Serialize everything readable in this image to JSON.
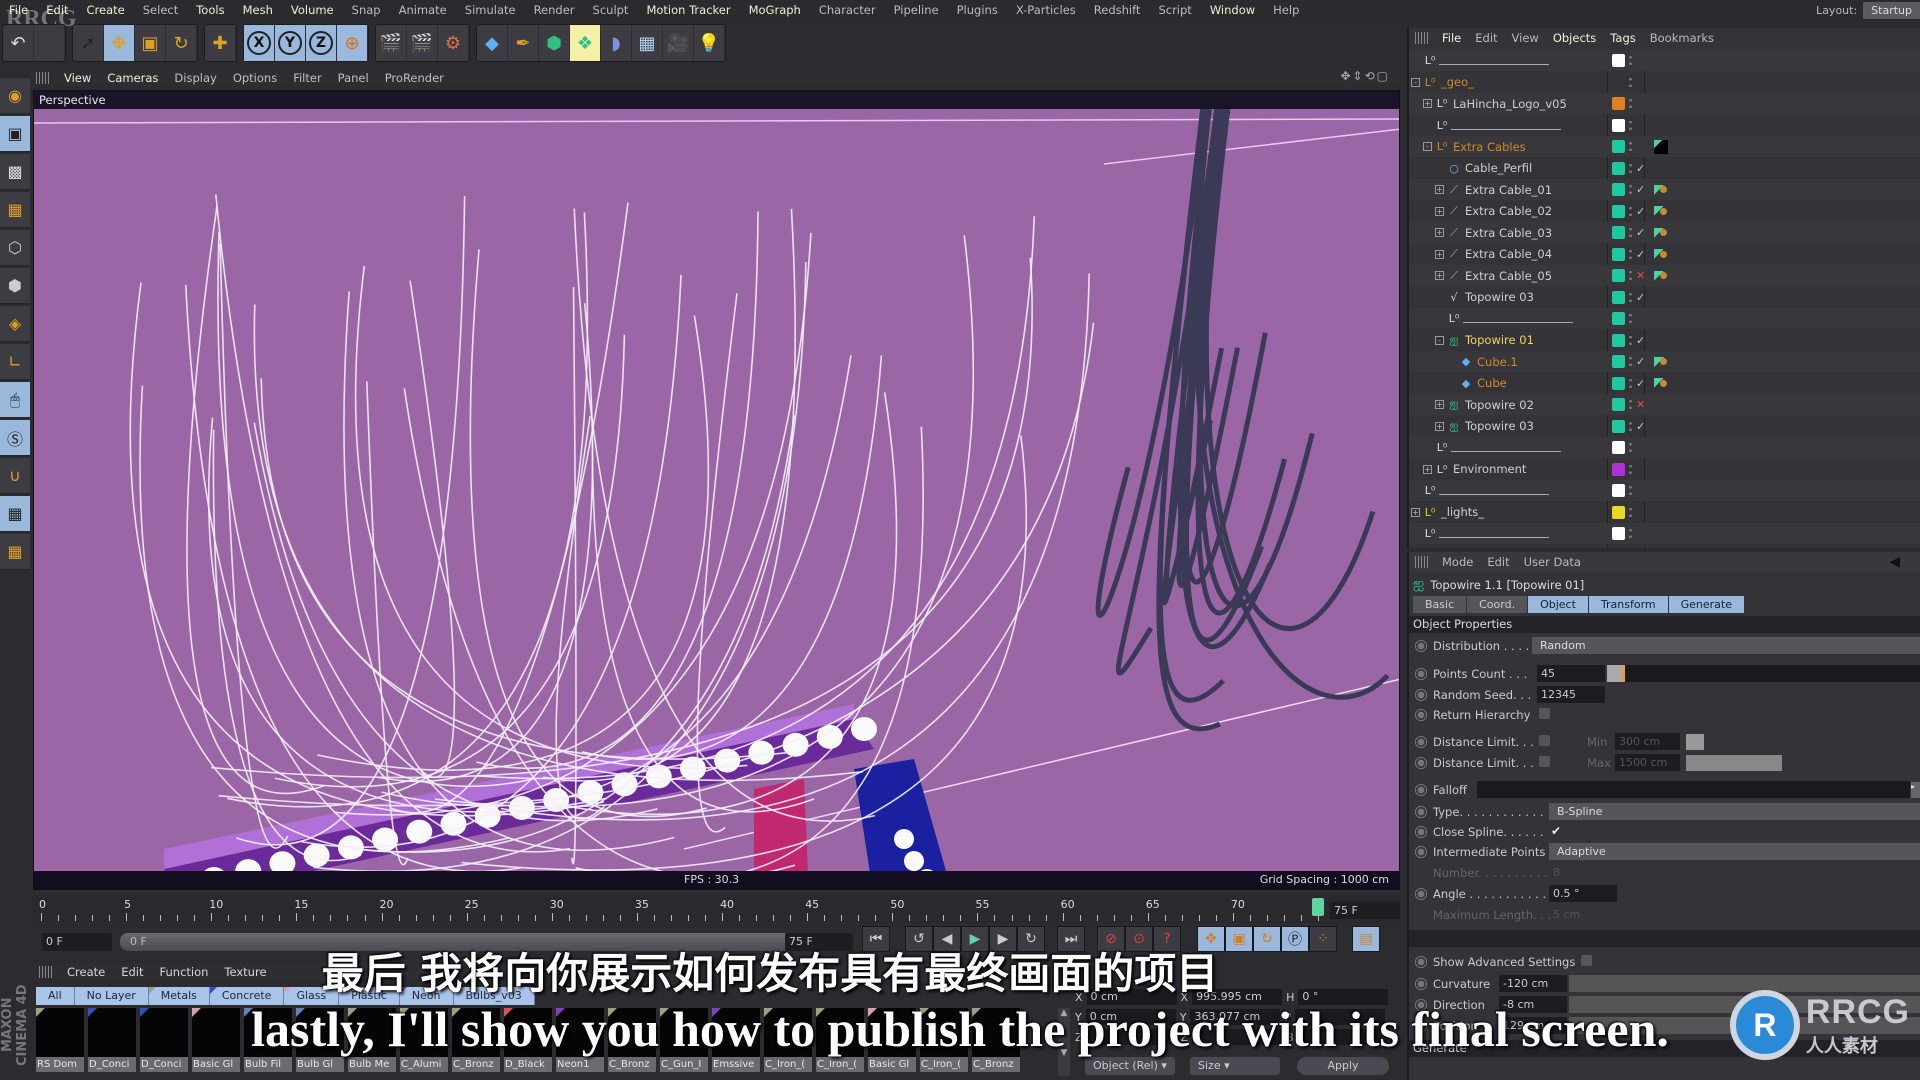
{
  "menubar": {
    "items": [
      "File",
      "Edit",
      "Create",
      "Select",
      "Tools",
      "Mesh",
      "Volume",
      "Snap",
      "Animate",
      "Simulate",
      "Render",
      "Sculpt",
      "Motion Tracker",
      "MoGraph",
      "Character",
      "Pipeline",
      "Plugins",
      "X-Particles",
      "Redshift",
      "Script",
      "Window",
      "Help"
    ],
    "layout_label": "Layout:",
    "layout_value": "Startup"
  },
  "toolbar": {
    "icons": [
      "undo-icon",
      "redo-icon",
      "select-icon",
      "move-icon",
      "scale-icon",
      "rotate-icon",
      "live-move-icon",
      "x-axis-icon",
      "y-axis-icon",
      "z-axis-icon",
      "world-coords-icon",
      "render-view-icon",
      "render-picture-viewer-icon",
      "render-settings-icon",
      "cube-icon",
      "pen-icon",
      "subdivision-icon",
      "cloner-icon",
      "deformer-icon",
      "floor-icon",
      "camera-icon",
      "light-icon"
    ],
    "axis_labels": [
      "X",
      "Y",
      "Z"
    ]
  },
  "viewport": {
    "menu": [
      "View",
      "Cameras",
      "Display",
      "Options",
      "Filter",
      "Panel",
      "ProRender"
    ],
    "label": "Perspective",
    "fps": "FPS : 30.3",
    "grid_spacing": "Grid Spacing : 1000 cm",
    "background_color": "#9a66a6"
  },
  "timeline": {
    "ticks": [
      0,
      5,
      10,
      15,
      20,
      25,
      30,
      35,
      40,
      45,
      50,
      55,
      60,
      65,
      70
    ],
    "current_frame": 75,
    "end_frame": "75 F",
    "start_field": "0 F",
    "range_start": "0 F",
    "range_end": "75 F",
    "range_end_field": "75 F"
  },
  "material_manager": {
    "menu": [
      "Create",
      "Edit",
      "Function",
      "Texture"
    ],
    "tabs": [
      {
        "label": "All",
        "color": "#a8c4e8"
      },
      {
        "label": "No Layer",
        "color": "#a8c4e8"
      },
      {
        "label": "Metals",
        "color": "#a0a080"
      },
      {
        "label": "Concrete",
        "color": "#3050c0"
      },
      {
        "label": "Glass",
        "color": "#d8a0b0"
      },
      {
        "label": "Plastic",
        "color": "#e05050"
      },
      {
        "label": "Neon",
        "color": "#8040c0"
      },
      {
        "label": "Bulbs_v03",
        "color": "#a8c4e8"
      }
    ],
    "materials": [
      {
        "name": "RS Dom",
        "color": "#a0a080"
      },
      {
        "name": "D_Conci",
        "color": "#3050c0"
      },
      {
        "name": "D_Conci",
        "color": "#3050c0"
      },
      {
        "name": "Basic Gl",
        "color": "#d8a0b0"
      },
      {
        "name": "Bulb Fil",
        "color": "#6080c0"
      },
      {
        "name": "Bulb Gl",
        "color": "#6080c0"
      },
      {
        "name": "Bulb Me",
        "color": "#a0a080"
      },
      {
        "name": "C_Alumi",
        "color": "#a0a080"
      },
      {
        "name": "C_Bronz",
        "color": "#a0a080"
      },
      {
        "name": "D_Black",
        "color": "#e05050"
      },
      {
        "name": "Neon1",
        "color": "#8040c0"
      },
      {
        "name": "C_Bronz",
        "color": "#a0a080"
      },
      {
        "name": "C_Gun_I",
        "color": "#a0a080"
      },
      {
        "name": "Emssive",
        "color": "#8040c0"
      },
      {
        "name": "C_Iron_(",
        "color": "#a0a080"
      },
      {
        "name": "C_Iron_(",
        "color": "#a0a080"
      },
      {
        "name": "Basic Gl",
        "color": "#d8a0b0"
      },
      {
        "name": "C_Iron_(",
        "color": "#a0a080"
      },
      {
        "name": "C_Bronz",
        "color": "#a0a080"
      }
    ]
  },
  "coordinates": {
    "position": {
      "x": "0 cm",
      "y": "0 cm"
    },
    "size": {
      "x": "995.995 cm",
      "y": "363.077 cm"
    },
    "rotation": {
      "h": "0 °"
    },
    "axis_labels": {
      "x": "X",
      "y": "Y",
      "z": "Z",
      "h": "H",
      "p": "P",
      "b": "B"
    },
    "mode_dropdown": "Object (Rel)",
    "size_dropdown": "Size",
    "apply_label": "Apply"
  },
  "object_manager": {
    "menu": [
      "File",
      "Edit",
      "View",
      "Objects",
      "Tags",
      "Bookmarks"
    ],
    "objects": [
      {
        "name": "",
        "type": "null-separator",
        "indent": 0,
        "swatch": "#ffffff",
        "check": ""
      },
      {
        "name": "_geo_",
        "type": "null",
        "indent": 0,
        "swatch": "",
        "check": "",
        "color": "orange",
        "expand": "-"
      },
      {
        "name": "LaHincha_Logo_v05",
        "type": "null",
        "indent": 1,
        "swatch": "#e08020",
        "check": "",
        "expand": "+"
      },
      {
        "name": "",
        "type": "null-separator",
        "indent": 1,
        "swatch": "#ffffff",
        "check": ""
      },
      {
        "name": "Extra Cables",
        "type": "null",
        "indent": 1,
        "swatch": "#1ec8a0",
        "check": "",
        "color": "orange",
        "expand": "-",
        "tag": "texture"
      },
      {
        "name": "Cable_Perfil",
        "type": "circle",
        "indent": 2,
        "swatch": "#1ec8a0",
        "check": "ok"
      },
      {
        "name": "Extra Cable_01",
        "type": "sweep",
        "indent": 2,
        "swatch": "#1ec8a0",
        "check": "ok",
        "expand": "+",
        "tag": "material"
      },
      {
        "name": "Extra Cable_02",
        "type": "sweep",
        "indent": 2,
        "swatch": "#1ec8a0",
        "check": "ok",
        "expand": "+",
        "tag": "material"
      },
      {
        "name": "Extra Cable_03",
        "type": "sweep",
        "indent": 2,
        "swatch": "#1ec8a0",
        "check": "ok",
        "expand": "+",
        "tag": "material"
      },
      {
        "name": "Extra Cable_04",
        "type": "sweep",
        "indent": 2,
        "swatch": "#1ec8a0",
        "check": "ok",
        "expand": "+",
        "tag": "material"
      },
      {
        "name": "Extra Cable_05",
        "type": "sweep",
        "indent": 2,
        "swatch": "#1ec8a0",
        "check": "off",
        "expand": "+",
        "tag": "material"
      },
      {
        "name": "Topowire 03",
        "type": "spline",
        "indent": 2,
        "swatch": "#1ec8a0",
        "check": "ok"
      },
      {
        "name": "",
        "type": "null-separator",
        "indent": 2,
        "swatch": "#1ec8a0",
        "check": ""
      },
      {
        "name": "Topowire 01",
        "type": "topowire",
        "indent": 2,
        "swatch": "#1ec8a0",
        "check": "ok",
        "color": "yellow",
        "expand": "-"
      },
      {
        "name": "Cube.1",
        "type": "cube",
        "indent": 3,
        "swatch": "#1ec8a0",
        "check": "ok",
        "color": "orange",
        "tag": "material"
      },
      {
        "name": "Cube",
        "type": "cube",
        "indent": 3,
        "swatch": "#1ec8a0",
        "check": "ok",
        "color": "orange",
        "tag": "material"
      },
      {
        "name": "Topowire 02",
        "type": "topowire",
        "indent": 2,
        "swatch": "#1ec8a0",
        "check": "off",
        "expand": "+"
      },
      {
        "name": "Topowire 03",
        "type": "topowire",
        "indent": 2,
        "swatch": "#1ec8a0",
        "check": "ok",
        "expand": "+"
      },
      {
        "name": "",
        "type": "null-separator",
        "indent": 1,
        "swatch": "#ffffff",
        "check": ""
      },
      {
        "name": "Environment",
        "type": "null",
        "indent": 1,
        "swatch": "#b030d8",
        "check": "",
        "expand": "+"
      },
      {
        "name": "",
        "type": "null-separator",
        "indent": 0,
        "swatch": "#ffffff",
        "check": ""
      },
      {
        "name": "_lights_",
        "type": "null",
        "indent": 0,
        "swatch": "#e8d820",
        "check": "",
        "expand": "+"
      },
      {
        "name": "",
        "type": "null-separator",
        "indent": 0,
        "swatch": "#ffffff",
        "check": ""
      }
    ]
  },
  "attribute_manager": {
    "menu": [
      "Mode",
      "Edit",
      "User Data"
    ],
    "title": "Topowire 1.1 [Topowire 01]",
    "tabs": [
      "Basic",
      "Coord.",
      "Object",
      "Transform",
      "Generate"
    ],
    "active_tabs": [
      "Object",
      "Transform",
      "Generate"
    ],
    "section_object": "Object Properties",
    "distribution_label": "Distribution . . . .",
    "distribution_value": "Random",
    "points_count_label": "Points Count . . .",
    "points_count_value": "45",
    "random_seed_label": "Random Seed. . .",
    "random_seed_value": "12345",
    "return_hierarchy_label": "Return Hierarchy",
    "distance_min_label": "Distance Limit. . .",
    "min_label": "Min",
    "min_value": "300 cm",
    "distance_max_label": "Distance Limit. . .",
    "max_label": "Max",
    "max_value": "1500 cm",
    "falloff_label": "Falloff",
    "type_label": "Type. . . . . . . . . . . .",
    "type_value": "B-Spline",
    "close_spline_label": "Close Spline. . . . . .",
    "close_spline_checked": true,
    "intermediate_label": "Intermediate Points",
    "intermediate_value": "Adaptive",
    "number_label": "Number. . . . . . . . . .",
    "number_value": "8",
    "angle_label": "Angle . . . . . . . . . . .",
    "angle_value": "0.5 °",
    "max_length_label": "Maximum Length. . .",
    "max_length_value": "5 cm",
    "advanced_label": "Show Advanced Settings",
    "curvature_label": "Curvature",
    "curvature_value": "-120 cm",
    "direction_label": "Direction",
    "direction_value": "-8 cm",
    "position_label": "Position",
    "position_value": "129 cm",
    "section_generate": "Generate"
  },
  "subtitles": {
    "chinese": "最后 我将向你展示如何发布具有最终画面的项目",
    "english": "lastly, I'll show you how to publish the project with its final screen."
  },
  "branding": {
    "app": "MAXON CINEMA 4D",
    "watermark": "RRCG",
    "logo_text": "RRCG",
    "logo_subtext": "人人素材"
  }
}
